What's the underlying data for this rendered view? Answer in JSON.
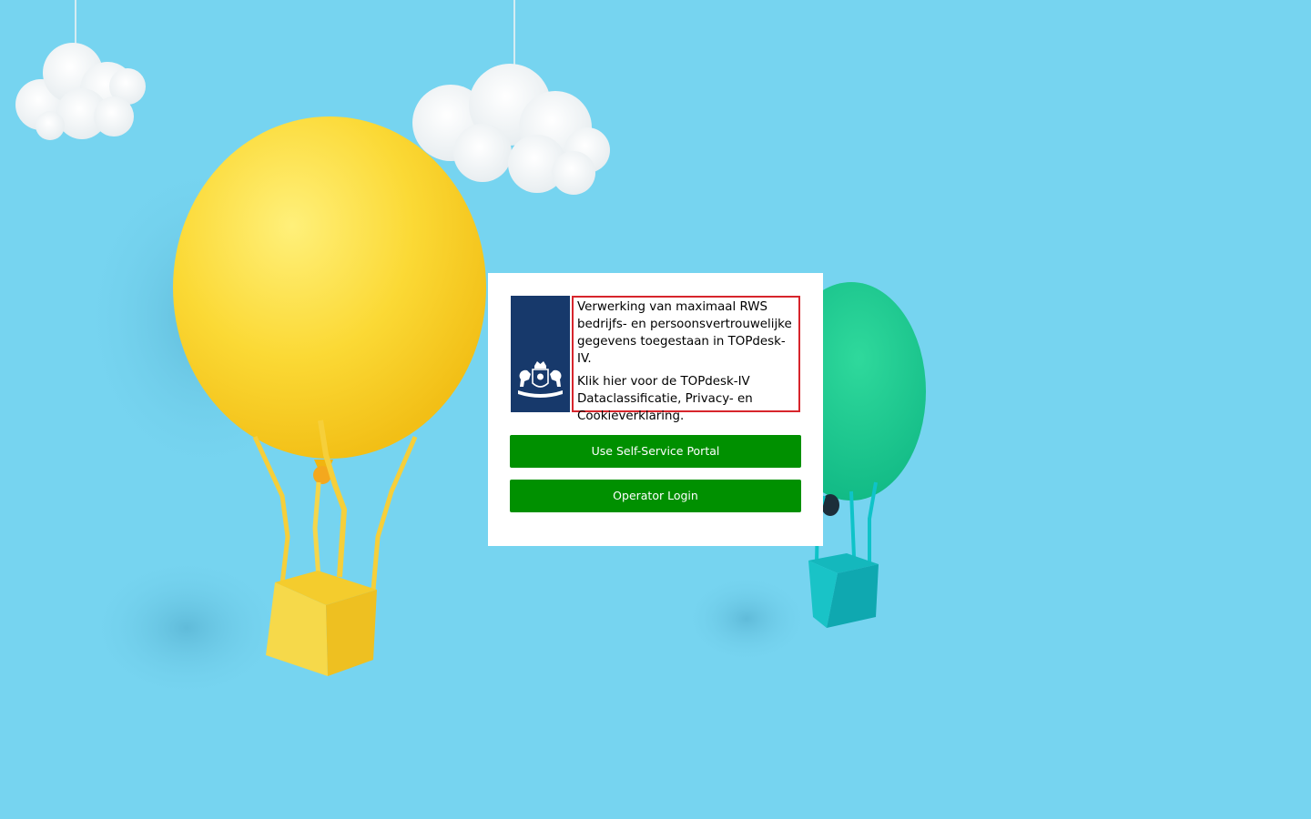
{
  "notice": {
    "line1": "Verwerking van maximaal RWS bedrijfs- en persoonsvertrouwelijke gegevens toegestaan in TOPdesk-IV.",
    "line2": "Klik hier voor de TOPdesk-IV Dataclassificatie, Privacy- en Cookieverklaring."
  },
  "buttons": {
    "self_service": "Use Self-Service Portal",
    "operator": "Operator Login"
  },
  "colors": {
    "background": "#76d4f0",
    "logo_blue": "#17396b",
    "button_green": "#009000",
    "notice_border": "#d7252c"
  },
  "icons": {
    "logo": "dutch-coat-of-arms-icon"
  }
}
